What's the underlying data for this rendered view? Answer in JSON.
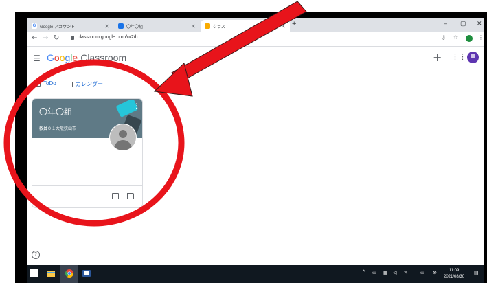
{
  "browser": {
    "tabs": [
      {
        "label": "Google アカウント",
        "favicon": "G"
      },
      {
        "label": "〇年〇組",
        "favicon": "classroom"
      },
      {
        "label": "クラス",
        "favicon": "classroom"
      }
    ],
    "new_tab": "+",
    "url": "classroom.google.com/u/2/h",
    "window_controls": [
      "–",
      "▢",
      "✕"
    ]
  },
  "app": {
    "logo_google": [
      "G",
      "o",
      "o",
      "g",
      "l",
      "e"
    ],
    "product": "Classroom",
    "add_label": "+",
    "apps_label": "⋮⋮⋮"
  },
  "toolbar": {
    "todo_label": "ToDo",
    "calendar_label": "カレンダー"
  },
  "class_card": {
    "title": "〇年〇組",
    "subtitle": "教員０１大阪狭山市",
    "more_label": "⋮"
  },
  "help_label": "?",
  "taskbar": {
    "time": "11:09",
    "date": "2021/08/30"
  },
  "annotation": {
    "arrow_color": "#e8141b",
    "circle_color": "#e8141b"
  }
}
